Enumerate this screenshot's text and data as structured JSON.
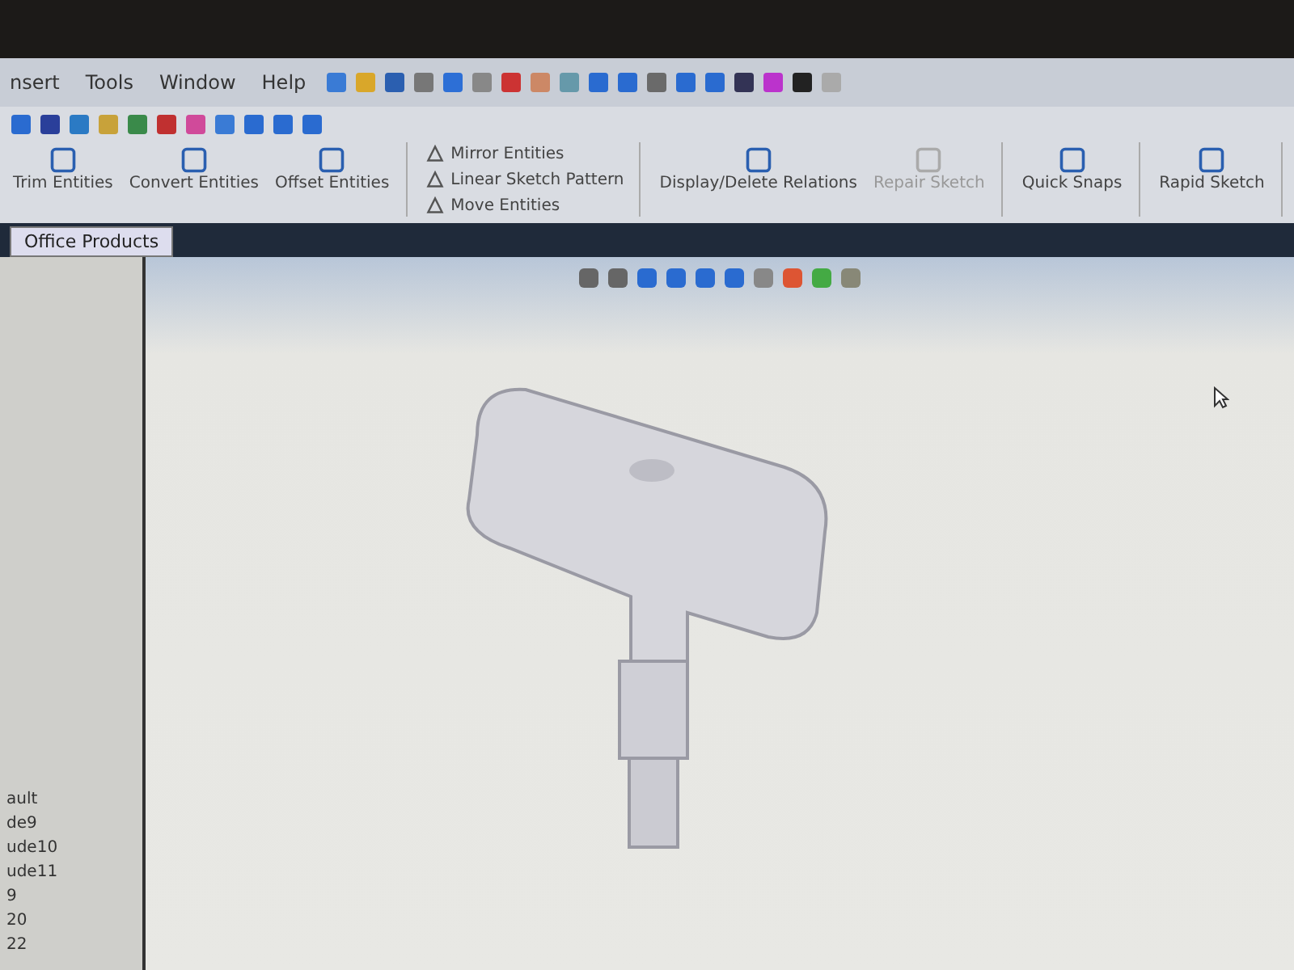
{
  "menu": [
    {
      "label": "nsert"
    },
    {
      "label": "Tools"
    },
    {
      "label": "Window"
    },
    {
      "label": "Help"
    }
  ],
  "command_manager": {
    "groups": [
      {
        "kind": "large",
        "items": [
          {
            "label": "Trim Entities",
            "disabled": false
          },
          {
            "label": "Convert Entities",
            "disabled": false
          },
          {
            "label": "Offset Entities",
            "disabled": false
          }
        ]
      },
      {
        "kind": "small",
        "items": [
          {
            "label": "Mirror Entities",
            "disabled": false
          },
          {
            "label": "Linear Sketch Pattern",
            "disabled": false
          },
          {
            "label": "Move Entities",
            "disabled": false
          }
        ]
      },
      {
        "kind": "large",
        "items": [
          {
            "label": "Display/Delete Relations",
            "disabled": false
          },
          {
            "label": "Repair Sketch",
            "disabled": true
          }
        ]
      },
      {
        "kind": "large",
        "items": [
          {
            "label": "Quick Snaps",
            "disabled": false
          }
        ]
      },
      {
        "kind": "large",
        "items": [
          {
            "label": "Rapid Sketch",
            "disabled": false
          }
        ]
      }
    ]
  },
  "tabs": [
    {
      "label": "Office Products",
      "selected": true
    }
  ],
  "feature_tree": {
    "items": [
      "ault",
      "de9",
      "ude10",
      "ude11",
      "9",
      "20",
      "22"
    ]
  }
}
